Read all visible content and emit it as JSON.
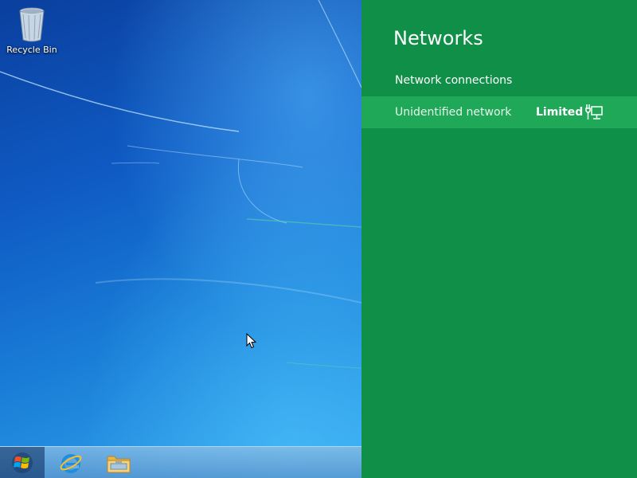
{
  "desktop": {
    "icons": [
      {
        "label": "Recycle Bin",
        "icon": "recycle-bin-icon"
      }
    ]
  },
  "taskbar": {
    "buttons": [
      {
        "name": "start",
        "icon": "windows-logo-icon"
      },
      {
        "name": "internet-explorer",
        "icon": "internet-explorer-icon"
      },
      {
        "name": "file-explorer",
        "icon": "folder-icon"
      }
    ]
  },
  "network_pane": {
    "title": "Networks",
    "section_heading": "Network connections",
    "connections": [
      {
        "name": "Unidentified network",
        "status": "Limited",
        "icon": "wired-network-icon"
      }
    ]
  },
  "colors": {
    "pane_background": "#0f8f47",
    "selected_item": "#1fa857",
    "wallpaper_dark": "#0a3f9e",
    "wallpaper_light": "#36a8ee"
  }
}
